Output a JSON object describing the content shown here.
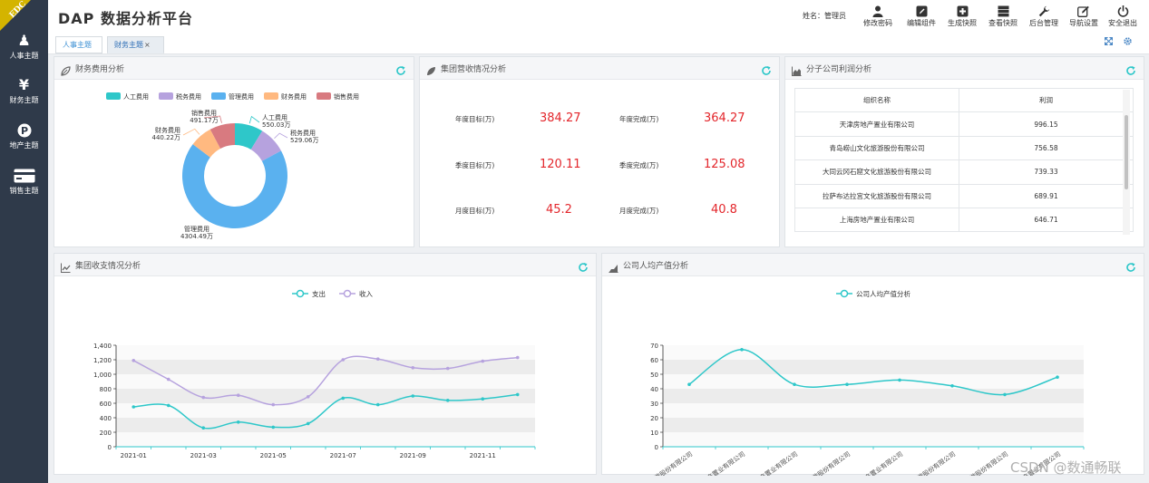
{
  "brand_badge": "EDC",
  "sidebar": {
    "items": [
      {
        "label": "人事主题",
        "icon": "person-icon",
        "glyph": "♟"
      },
      {
        "label": "财务主题",
        "icon": "yen-icon",
        "glyph": "¥"
      },
      {
        "label": "地产主题",
        "icon": "pinterest-icon",
        "glyph": "P"
      },
      {
        "label": "销售主题",
        "icon": "credit-card-icon",
        "glyph": "▬"
      }
    ]
  },
  "header": {
    "title": "DAP 数据分析平台",
    "user_label": "姓名：管理员",
    "tools": [
      {
        "label": "修改密码",
        "icon": "user-icon",
        "glyph": "☺"
      },
      {
        "label": "编辑组件",
        "icon": "edit-icon",
        "glyph": "✎"
      },
      {
        "label": "生成快照",
        "icon": "plus-square-icon",
        "glyph": "⊞"
      },
      {
        "label": "查看快照",
        "icon": "server-icon",
        "glyph": "≡"
      },
      {
        "label": "后台管理",
        "icon": "wrench-icon",
        "glyph": "⚒"
      },
      {
        "label": "导航设置",
        "icon": "edit-outline-icon",
        "glyph": "✍"
      },
      {
        "label": "安全退出",
        "icon": "power-icon",
        "glyph": "⏻"
      }
    ],
    "tabs": [
      {
        "label": "人事主题"
      },
      {
        "label": "财务主题"
      }
    ],
    "tab_close": "×"
  },
  "panels": {
    "expense": {
      "title": "财务费用分析",
      "chart_data": {
        "type": "pie",
        "title": "",
        "legend_position": "top",
        "slices": [
          {
            "name": "人工费用",
            "value": 550.03,
            "label": "550.03万",
            "color": "#2ec7c9"
          },
          {
            "name": "税务费用",
            "value": 529.06,
            "label": "529.06万",
            "color": "#b6a2de"
          },
          {
            "name": "管理费用",
            "value": 4304.49,
            "label": "4304.49万",
            "color": "#5ab1ef"
          },
          {
            "name": "财务费用",
            "value": 440.22,
            "label": "440.22万",
            "color": "#ffb980"
          },
          {
            "name": "销售费用",
            "value": 491.17,
            "label": "491.17万",
            "color": "#d87a80"
          }
        ]
      }
    },
    "revenue": {
      "title": "集团营收情况分析",
      "kpis": [
        {
          "label": "年度目标(万)",
          "value": "384.27"
        },
        {
          "label": "年度完成(万)",
          "value": "364.27"
        },
        {
          "label": "季度目标(万)",
          "value": "120.11"
        },
        {
          "label": "季度完成(万)",
          "value": "125.08"
        },
        {
          "label": "月度目标(万)",
          "value": "45.2"
        },
        {
          "label": "月度完成(万)",
          "value": "40.8"
        }
      ]
    },
    "profit": {
      "title": "分子公司利润分析",
      "columns": [
        "组织名称",
        "利润"
      ],
      "rows": [
        [
          "天津房地产置业有限公司",
          "996.15"
        ],
        [
          "青岛崂山文化旅游股份有限公司",
          "756.58"
        ],
        [
          "大同云冈石窟文化旅游股份有限公司",
          "739.33"
        ],
        [
          "拉萨布达拉宫文化旅游股份有限公司",
          "689.91"
        ],
        [
          "上海房地产置业有限公司",
          "646.71"
        ]
      ]
    },
    "cashflow": {
      "title": "集团收支情况分析",
      "chart_data": {
        "type": "line",
        "title": "",
        "legend_position": "top",
        "x": [
          "2021-01",
          "2021-02",
          "2021-03",
          "2021-04",
          "2021-05",
          "2021-06",
          "2021-07",
          "2021-08",
          "2021-09",
          "2021-10",
          "2021-11",
          "2021-12"
        ],
        "x_tick_labels": [
          "2021-01",
          "2021-03",
          "2021-05",
          "2021-07",
          "2021-09",
          "2021-11"
        ],
        "ylim": [
          0,
          1400
        ],
        "y_ticks": [
          "0",
          "200",
          "400",
          "600",
          "800",
          "1,000",
          "1,200",
          "1,400"
        ],
        "series": [
          {
            "name": "支出",
            "color": "#2ec7c9",
            "values": [
              550,
              570,
              260,
              340,
              270,
              320,
              670,
              580,
              700,
              640,
              660,
              720
            ]
          },
          {
            "name": "收入",
            "color": "#b6a2de",
            "values": [
              1190,
              930,
              680,
              710,
              580,
              690,
              1200,
              1210,
              1090,
              1080,
              1180,
              1230
            ]
          }
        ]
      }
    },
    "per_capita": {
      "title": "公司人均产值分析",
      "chart_data": {
        "type": "line",
        "title": "",
        "legend_position": "top",
        "x_tick_labels_partial": [
          "...旅游股份有限公司",
          "...地产置业有限公司",
          "...地产置业有限公司",
          "...旅游股份有限公司",
          "...地产置业有限公司",
          "...旅游股份有限公司",
          "...旅游股份有限公司",
          "...地产置业有限公司"
        ],
        "ylim": [
          0,
          70
        ],
        "y_ticks": [
          "0",
          "10",
          "20",
          "30",
          "40",
          "50",
          "60",
          "70"
        ],
        "series": [
          {
            "name": "公司人均产值分析",
            "color": "#2ec7c9",
            "values": [
              43,
              67,
              43,
              43,
              46,
              42,
              36,
              48
            ]
          }
        ]
      }
    }
  },
  "watermark": "CSDN @数通畅联"
}
